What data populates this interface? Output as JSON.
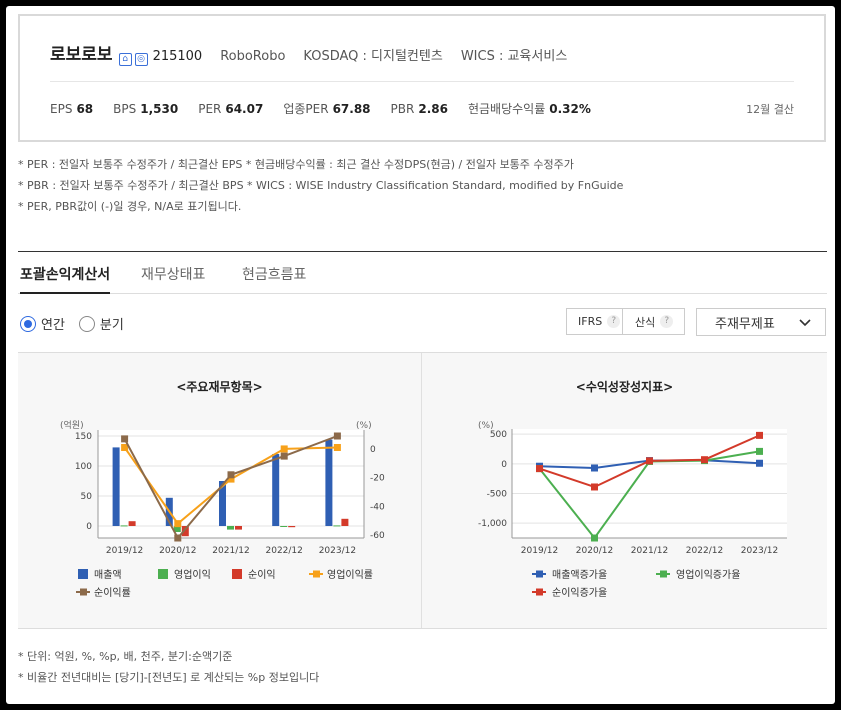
{
  "company": {
    "name": "로보로보",
    "code": "215100",
    "eng_name": "RoboRobo",
    "market": "KOSDAQ : 디지털컨텐츠",
    "wics": "WICS : 교육서비스"
  },
  "metrics": [
    {
      "label": "EPS",
      "value": "68"
    },
    {
      "label": "BPS",
      "value": "1,530"
    },
    {
      "label": "PER",
      "value": "64.07"
    },
    {
      "label": "업종PER",
      "value": "67.88"
    },
    {
      "label": "PBR",
      "value": "2.86"
    },
    {
      "label": "현금배당수익률",
      "value": "0.32%"
    }
  ],
  "settlement": "12월 결산",
  "notes": [
    "* PER : 전일자 보통주 수정주가 / 최근결산 EPS * 현금배당수익률 : 최근 결산 수정DPS(현금) / 전일자 보통주 수정주가",
    "* PBR : 전일자 보통주 수정주가 / 최근결산 BPS * WICS : WISE Industry Classification Standard, modified by FnGuide",
    "* PER, PBR값이 (-)일 경우, N/A로 표기됩니다."
  ],
  "tabs": [
    "포괄손익계산서",
    "재무상태표",
    "현금흐름표"
  ],
  "period": {
    "annual": "연간",
    "quarter": "분기"
  },
  "tools": {
    "ifrs": "IFRS",
    "calc": "산식",
    "qmark": "?",
    "select": "주재무제표"
  },
  "chart_data": [
    {
      "type": "bar",
      "title": "<주요재무항목>",
      "y_unit": "(억원)",
      "y2_unit": "(%)",
      "categories": [
        "2019/12",
        "2020/12",
        "2021/12",
        "2022/12",
        "2023/12"
      ],
      "ylim": [
        -20,
        150
      ],
      "y_ticks": [
        0,
        50,
        100,
        150
      ],
      "y2lim": [
        -62,
        9
      ],
      "y2_ticks": [
        0,
        -20,
        -40,
        -60
      ],
      "colors": {
        "sales": "#2f5fb3",
        "op_income": "#4caf50",
        "net_income": "#d33a2a",
        "op_margin": "#f7a11a",
        "net_margin": "#8c6a4a"
      },
      "series": [
        {
          "name": "매출액",
          "kind": "bar",
          "axis": "left",
          "values": [
            131,
            47,
            75,
            120,
            144
          ]
        },
        {
          "name": "영업이익",
          "kind": "bar",
          "axis": "left",
          "values": [
            1,
            -10,
            -6,
            -1,
            1
          ]
        },
        {
          "name": "순이익",
          "kind": "bar",
          "axis": "left",
          "values": [
            8,
            -17,
            -6,
            -2,
            12
          ]
        },
        {
          "name": "영업이익률",
          "kind": "line",
          "axis": "right",
          "values": [
            1,
            -52,
            -21,
            0,
            1
          ]
        },
        {
          "name": "순이익률",
          "kind": "line",
          "axis": "right",
          "values": [
            7,
            -62,
            -18,
            -5,
            9
          ]
        }
      ]
    },
    {
      "type": "line",
      "title": "<수익성장성지표>",
      "y_unit": "(%)",
      "categories": [
        "2019/12",
        "2020/12",
        "2021/12",
        "2022/12",
        "2023/12"
      ],
      "ylim": [
        -1250,
        520
      ],
      "y_ticks": [
        500,
        0,
        -500,
        -1000
      ],
      "y_tick_labels": [
        "500",
        "0",
        "-500",
        "-1,000"
      ],
      "colors": {
        "sales_growth": "#2f5fb3",
        "op_growth": "#4caf50",
        "net_growth": "#d33a2a"
      },
      "series": [
        {
          "name": "매출액증가율",
          "values": [
            -40,
            -70,
            55,
            60,
            10
          ]
        },
        {
          "name": "영업이익증가율",
          "values": [
            -80,
            -1250,
            40,
            55,
            210
          ]
        },
        {
          "name": "순이익증가율",
          "values": [
            -80,
            -390,
            50,
            70,
            480
          ]
        }
      ]
    }
  ],
  "footer": [
    "* 단위: 억원, %, %p, 배, 천주, 분기:순액기준",
    "* 비율간 전년대비는 [당기]-[전년도] 로 계산되는 %p 정보입니다"
  ]
}
